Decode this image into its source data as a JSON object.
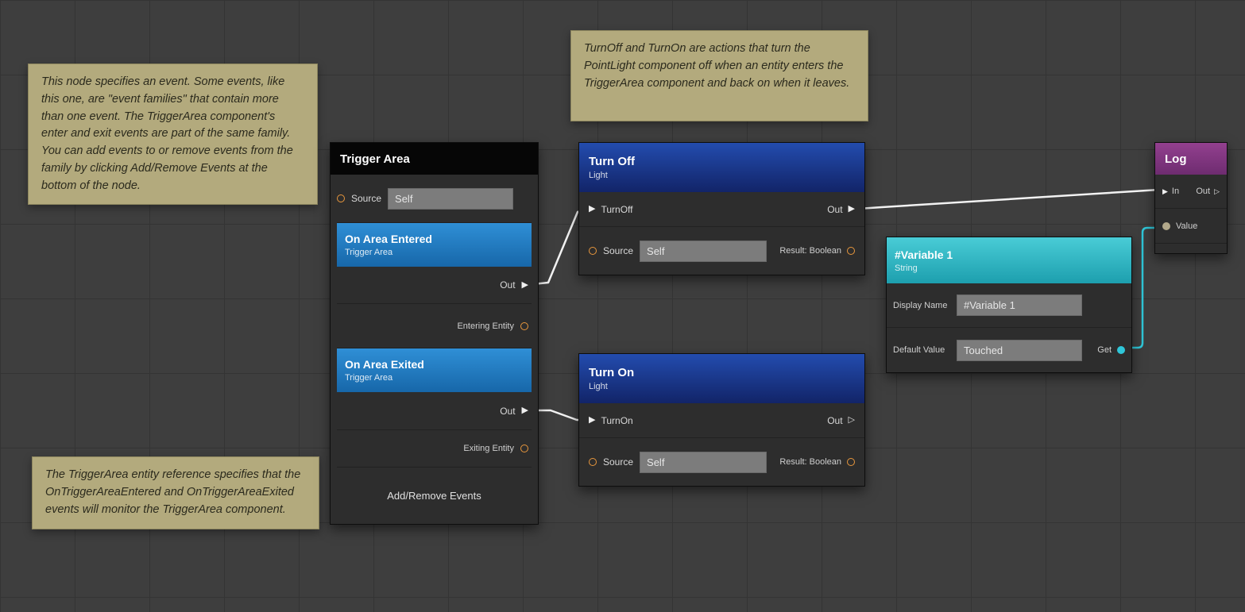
{
  "comments": {
    "event_note": {
      "text": "This node specifies an event. Some events, like this one, are \"event families\" that contain more than one event. The TriggerArea component's enter and exit events are part of the same family. You can add events to or remove events from the family by clicking Add/Remove Events at the bottom of the node."
    },
    "entity_note": {
      "text": "The TriggerArea entity reference specifies that the OnTriggerAreaEntered and OnTriggerAreaExited events will monitor the TriggerArea component."
    },
    "action_note": {
      "text": "TurnOff and TurnOn are actions that turn the PointLight component off when an entity enters the TriggerArea component and back on when it leaves."
    }
  },
  "nodes": {
    "trigger_area": {
      "title": "Trigger Area",
      "source_label": "Source",
      "source_value": "Self",
      "events": [
        {
          "title": "On Area Entered",
          "subtitle": "Trigger Area",
          "out_label": "Out",
          "entity_label": "Entering Entity"
        },
        {
          "title": "On Area Exited",
          "subtitle": "Trigger Area",
          "out_label": "Out",
          "entity_label": "Exiting Entity"
        }
      ],
      "footer_label": "Add/Remove Events"
    },
    "turn_off": {
      "title": "Turn Off",
      "subtitle": "Light",
      "in_label": "TurnOff",
      "out_label": "Out",
      "source_label": "Source",
      "source_value": "Self",
      "result_label": "Result: Boolean"
    },
    "turn_on": {
      "title": "Turn On",
      "subtitle": "Light",
      "in_label": "TurnOn",
      "out_label": "Out",
      "source_label": "Source",
      "source_value": "Self",
      "result_label": "Result: Boolean"
    },
    "variable_1": {
      "title": "#Variable 1",
      "subtitle": "String",
      "display_name_label": "Display Name",
      "display_name_value": "#Variable 1",
      "default_value_label": "Default Value",
      "default_value": "Touched",
      "get_label": "Get"
    },
    "log": {
      "title": "Log",
      "in_label": "In",
      "out_label": "Out",
      "value_label": "Value"
    }
  },
  "icons": {
    "exec_in": "▶",
    "exec_out_connected": "▶",
    "exec_out_open": "▷"
  },
  "colors": {
    "wire_exec": "#f2f2f2",
    "wire_data": "#2fc6d8",
    "port_orange": "#e8973d",
    "event_header": "#2787cf",
    "action_header": "#1d3f9f",
    "variable_header": "#35c1cf",
    "log_header": "#8a3a8c",
    "comment_bg": "#b3aa7d"
  }
}
